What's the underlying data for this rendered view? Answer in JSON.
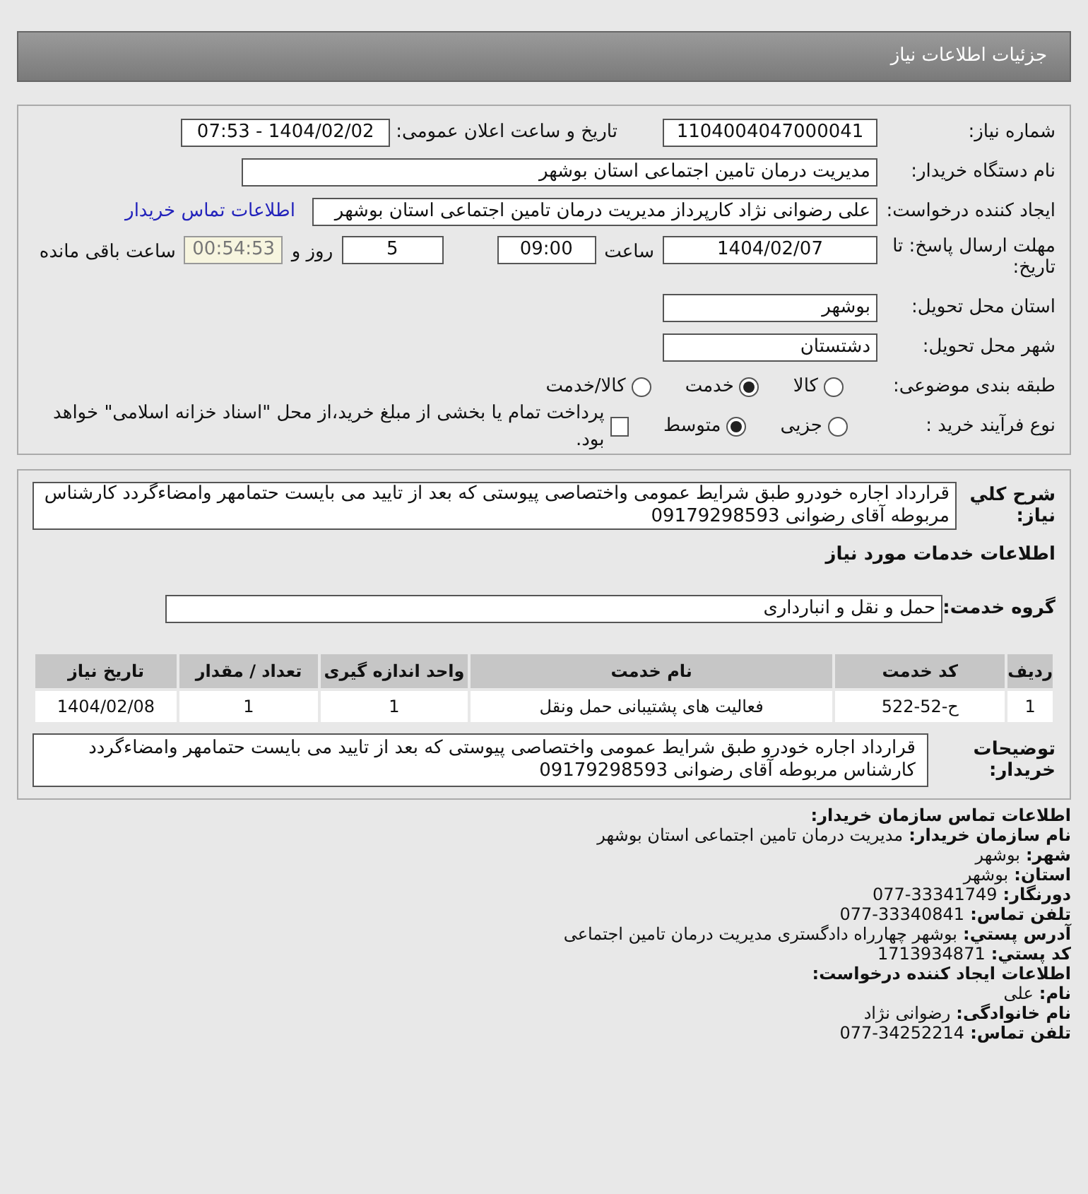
{
  "header": {
    "title": "جزئیات اطلاعات نیاز"
  },
  "form": {
    "need_number": {
      "label": "شماره نیاز:",
      "value": "1104004047000041"
    },
    "announce": {
      "label": "تاریخ و ساعت اعلان عمومی:",
      "value": "1404/02/02 - 07:53"
    },
    "buyer_org": {
      "label": "نام دستگاه خریدار:",
      "value": "مدیریت درمان تامین اجتماعی استان بوشهر"
    },
    "requester": {
      "label": "ایجاد کننده درخواست:",
      "value": "علی رضوانی نژاد کارپرداز مدیریت درمان تامین اجتماعی استان بوشهر",
      "link": "اطلاعات تماس خریدار"
    },
    "deadline": {
      "label": "مهلت ارسال پاسخ: تا تاریخ:",
      "date": "1404/02/07",
      "time_label": "ساعت",
      "time": "09:00",
      "days": "5",
      "days_label": "روز و",
      "remaining": "00:54:53",
      "remaining_label": "ساعت باقی مانده"
    },
    "province": {
      "label": "استان محل تحویل:",
      "value": "بوشهر"
    },
    "city": {
      "label": "شهر محل تحویل:",
      "value": "دشتستان"
    },
    "category": {
      "label": "طبقه بندی موضوعی:",
      "options": [
        {
          "label": "کالا",
          "selected": false
        },
        {
          "label": "خدمت",
          "selected": true
        },
        {
          "label": "کالا/خدمت",
          "selected": false
        }
      ]
    },
    "process": {
      "label": "نوع فرآیند خرید :",
      "options": [
        {
          "label": "جزیی",
          "selected": false
        },
        {
          "label": "متوسط",
          "selected": true
        }
      ],
      "payment": {
        "checked": false,
        "label": "پرداخت تمام یا بخشی از مبلغ خرید،از محل \"اسناد خزانه اسلامی\" خواهد بود."
      }
    }
  },
  "details": {
    "description": {
      "label": "شرح کلي نیاز:",
      "value": "قرارداد اجاره خودرو طبق شرایط عمومی واختصاصی پیوستی که بعد از تایید می بایست حتمامهر وامضاءگردد کارشناس مربوطه آقای رضوانی 09179298593"
    },
    "services_heading": "اطلاعات خدمات مورد نیاز",
    "service_group": {
      "label": "گروه خدمت:",
      "value": "حمل و نقل و انبارداری"
    },
    "table": {
      "columns": [
        "ردیف",
        "کد خدمت",
        "نام خدمت",
        "واحد اندازه گیری",
        "تعداد / مقدار",
        "تاریخ نیاز"
      ],
      "rows": [
        [
          "1",
          "ح-52-522",
          "فعالیت های پشتیبانی حمل ونقل",
          "1",
          "1",
          "1404/02/08"
        ]
      ]
    },
    "buyer_notes": {
      "label": "توضیحات خریدار:",
      "value": "قرارداد اجاره خودرو طبق شرایط عمومی واختصاصی پیوستی که بعد از تایید می بایست حتمامهر وامضاءگردد کارشناس مربوطه آقای رضوانی 09179298593"
    }
  },
  "contact": [
    {
      "kind": "heading",
      "label": "اطلاعات تماس سازمان خریدار:"
    },
    {
      "kind": "field",
      "label": "نام سازمان خریدار:",
      "value": "مدیریت درمان تامین اجتماعی استان بوشهر"
    },
    {
      "kind": "field",
      "label": "شهر:",
      "value": "بوشهر"
    },
    {
      "kind": "field",
      "label": "استان:",
      "value": "بوشهر"
    },
    {
      "kind": "field",
      "label": "دورنگار:",
      "value": "077-33341749"
    },
    {
      "kind": "field",
      "label": "تلفن تماس:",
      "value": "077-33340841"
    },
    {
      "kind": "field",
      "label": "آدرس پستي:",
      "value": "بوشهر چهارراه دادگستری مدیریت درمان تامین اجتماعی"
    },
    {
      "kind": "field",
      "label": "کد پستي:",
      "value": "1713934871"
    },
    {
      "kind": "heading",
      "label": "اطلاعات ایجاد کننده درخواست:"
    },
    {
      "kind": "field",
      "label": "نام:",
      "value": "علی"
    },
    {
      "kind": "field",
      "label": "نام خانوادگی:",
      "value": "رضوانی نژاد"
    },
    {
      "kind": "field",
      "label": "تلفن تماس:",
      "value": "077-34252214"
    }
  ]
}
